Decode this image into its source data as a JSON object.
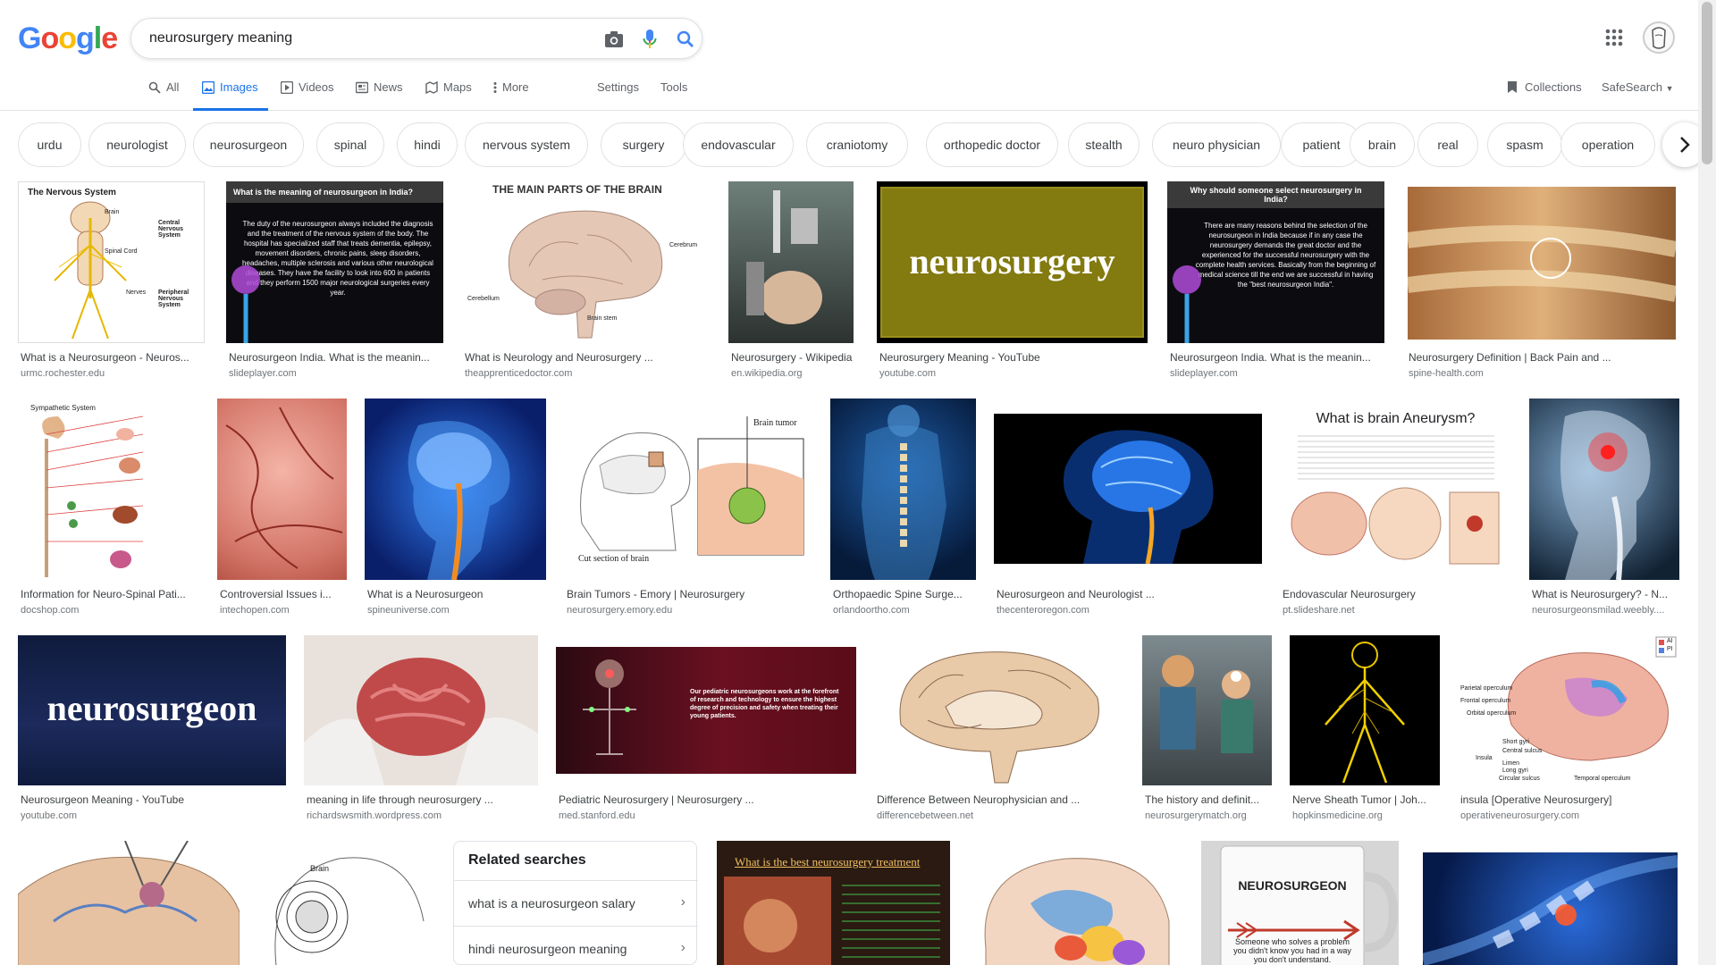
{
  "brand": {
    "logo_letters": [
      "G",
      "o",
      "o",
      "g",
      "l",
      "e"
    ],
    "logo_colors": [
      "#4285f4",
      "#ea4335",
      "#fbbc05",
      "#4285f4",
      "#34a853",
      "#ea4335"
    ]
  },
  "search": {
    "query": "neurosurgery meaning"
  },
  "tabs": [
    {
      "label": "All",
      "icon": "search-icon"
    },
    {
      "label": "Images",
      "icon": "image-icon",
      "active": true
    },
    {
      "label": "Videos",
      "icon": "play-icon"
    },
    {
      "label": "News",
      "icon": "news-icon"
    },
    {
      "label": "Maps",
      "icon": "map-icon"
    },
    {
      "label": "More",
      "icon": "more-vert-icon"
    }
  ],
  "tools": {
    "settings": "Settings",
    "tools": "Tools",
    "collections": "Collections",
    "safesearch": "SafeSearch"
  },
  "chips": [
    "urdu",
    "neurologist",
    "neurosurgeon",
    "spinal",
    "hindi",
    "nervous system",
    "surgery",
    "endovascular",
    "craniotomy",
    "orthopedic doctor",
    "stealth",
    "neuro physician",
    "patient",
    "brain",
    "real",
    "spasm",
    "operation"
  ],
  "results": [
    {
      "title": "What is a Neurosurgeon - Neuros...",
      "source": "urmc.rochester.edu"
    },
    {
      "title": "Neurosurgeon India. What is the meanin...",
      "source": "slideplayer.com"
    },
    {
      "title": "What is Neurology and Neurosurgery ...",
      "source": "theapprenticedoctor.com"
    },
    {
      "title": "Neurosurgery - Wikipedia",
      "source": "en.wikipedia.org"
    },
    {
      "title": "Neurosurgery Meaning - YouTube",
      "source": "youtube.com"
    },
    {
      "title": "Neurosurgeon India. What is the meanin...",
      "source": "slideplayer.com"
    },
    {
      "title": "Neurosurgery Definition | Back Pain and ...",
      "source": "spine-health.com"
    },
    {
      "title": "Information for Neuro-Spinal Pati...",
      "source": "docshop.com"
    },
    {
      "title": "Controversial Issues i...",
      "source": "intechopen.com"
    },
    {
      "title": "What is a Neurosurgeon",
      "source": "spineuniverse.com"
    },
    {
      "title": "Brain Tumors - Emory | Neurosurgery",
      "source": "neurosurgery.emory.edu"
    },
    {
      "title": "Orthopaedic Spine Surge...",
      "source": "orlandoortho.com"
    },
    {
      "title": "Neurosurgeon and Neurologist ...",
      "source": "thecenteroregon.com"
    },
    {
      "title": "Endovascular Neurosurgery",
      "source": "pt.slideshare.net"
    },
    {
      "title": "What is Neurosurgery? - N...",
      "source": "neurosurgeonsmilad.weebly...."
    },
    {
      "title": "Neurosurgeon Meaning - YouTube",
      "source": "youtube.com"
    },
    {
      "title": "meaning in life through neurosurgery ...",
      "source": "richardswsmith.wordpress.com"
    },
    {
      "title": "Pediatric Neurosurgery | Neurosurgery ...",
      "source": "med.stanford.edu"
    },
    {
      "title": "Difference Between Neurophysician and ...",
      "source": "differencebetween.net"
    },
    {
      "title": "The history and definit...",
      "source": "neurosurgerymatch.org"
    },
    {
      "title": "Nerve Sheath Tumor | Joh...",
      "source": "hopkinsmedicine.org"
    },
    {
      "title": "insula [Operative Neurosurgery]",
      "source": "operativeneurosurgery.com"
    }
  ],
  "thumb_text": {
    "t1_heading": "The Nervous System",
    "t1_labels": [
      "Brain",
      "Central Nervous System",
      "Spinal Cord",
      "Nerves",
      "Peripheral Nervous System"
    ],
    "t2_heading": "What is the meaning of neurosurgeon in India?",
    "t2_body": "The duty of the neurosurgeon always included the diagnosis and the treatment of the nervous system of the body. The hospital has specialized staff that treats dementia, epilepsy, movement disorders, chronic pains, sleep disorders, headaches, multiple sclerosis and various other neurological diseases. They have the facility to look into 600 in patients and they perform 1500 major neurological surgeries every year.",
    "t3_heading": "THE MAIN PARTS OF THE BRAIN",
    "t3_labels": [
      "Cerebrum",
      "Cerebellum",
      "Brain stem"
    ],
    "t5_word": "neurosurgery",
    "t6_heading": "Why should someone select neurosurgery in India?",
    "t6_body": "There are many reasons behind the selection of the neurosurgeon in India because if in any case the neurosurgery demands the great doctor and the experienced for the successful neurosurgery with the complete health services. Basically from the beginning of medical science till the end we are successful in having the \"best neurosurgeon India\".",
    "t8_heading": "Sympathetic System",
    "t11_labels": [
      "Brain tumor",
      "Cut section of brain"
    ],
    "t14_heading": "What is brain Aneurysm?",
    "t16_word": "neurosurgeon",
    "t18_body": "Our pediatric neurosurgeons work at the forefront of research and technology to ensure the highest degree of precision and safety when treating their young patients.",
    "t22_labels": [
      "Parietal operculum",
      "Frontal operculum",
      "Orbital operculum",
      "Short gyri",
      "Central sulcus",
      "Insula",
      "Limen",
      "Long gyri",
      "Circular sulcus",
      "Temporal operculum"
    ],
    "t22_badges": [
      "AI",
      "PI"
    ],
    "t24_label": "Brain",
    "t26_heading": "What is the best neurosurgery treatment",
    "t28_heading": "NEUROSURGEON",
    "t28_body": "Someone who solves a problem you didn't know you had in a way you don't understand."
  },
  "related": {
    "heading": "Related searches",
    "items": [
      "what is a neurosurgeon salary",
      "hindi neurosurgeon meaning"
    ]
  }
}
